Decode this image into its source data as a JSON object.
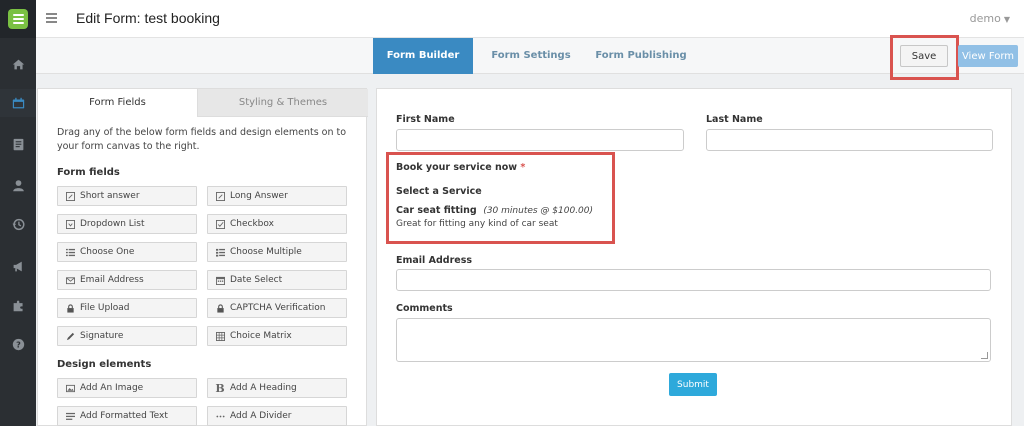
{
  "window": {
    "title": "Edit Form: test booking",
    "user": "demo"
  },
  "brand": {
    "accent": "#3a8ac2",
    "highlight": "#d9534f",
    "sidebar_bg": "#2b2f33",
    "submit": "#2ea9db"
  },
  "sidebar": {
    "icons": [
      "home-icon",
      "calendar-icon",
      "document-icon",
      "user-icon",
      "history-icon",
      "megaphone-icon",
      "puzzle-icon",
      "help-icon"
    ]
  },
  "tabs": [
    {
      "label": "Form Builder",
      "active": true
    },
    {
      "label": "Form Settings",
      "active": false
    },
    {
      "label": "Form Publishing",
      "active": false
    }
  ],
  "toolbar": {
    "save_label": "Save",
    "view_label": "View Form"
  },
  "left_panel": {
    "tabs": [
      {
        "label": "Form Fields",
        "active": true
      },
      {
        "label": "Styling & Themes",
        "active": false
      }
    ],
    "instructions": "Drag any of the below form fields and design elements on to your form canvas to the right.",
    "form_fields_title": "Form fields",
    "form_fields": [
      {
        "label": "Short answer",
        "icon": "edit-icon"
      },
      {
        "label": "Long Answer",
        "icon": "edit-icon"
      },
      {
        "label": "Dropdown List",
        "icon": "dropdown-icon"
      },
      {
        "label": "Checkbox",
        "icon": "checkbox-icon"
      },
      {
        "label": "Choose One",
        "icon": "list-icon"
      },
      {
        "label": "Choose Multiple",
        "icon": "list-icon"
      },
      {
        "label": "Email Address",
        "icon": "envelope-icon"
      },
      {
        "label": "Date Select",
        "icon": "calendar-icon"
      },
      {
        "label": "File Upload",
        "icon": "lock-icon"
      },
      {
        "label": "CAPTCHA Verification",
        "icon": "lock-icon"
      },
      {
        "label": "Signature",
        "icon": "pen-icon"
      },
      {
        "label": "Choice Matrix",
        "icon": "grid-icon"
      }
    ],
    "design_title": "Design elements",
    "design_elements": [
      {
        "label": "Add An Image",
        "icon": "image-icon"
      },
      {
        "label": "Add A Heading",
        "icon": "bold-icon"
      },
      {
        "label": "Add Formatted Text",
        "icon": "text-icon"
      },
      {
        "label": "Add A Divider",
        "icon": "dots-icon"
      }
    ]
  },
  "canvas": {
    "first_name_label": "First Name",
    "last_name_label": "Last Name",
    "booking": {
      "title": "Book your service now",
      "required_mark": "*",
      "select_label": "Select a Service",
      "service_name": "Car seat fitting",
      "service_meta": "(30 minutes @ $100.00)",
      "service_desc": "Great for fitting any kind of car seat"
    },
    "email_label": "Email Address",
    "comments_label": "Comments",
    "submit_label": "Submit"
  }
}
